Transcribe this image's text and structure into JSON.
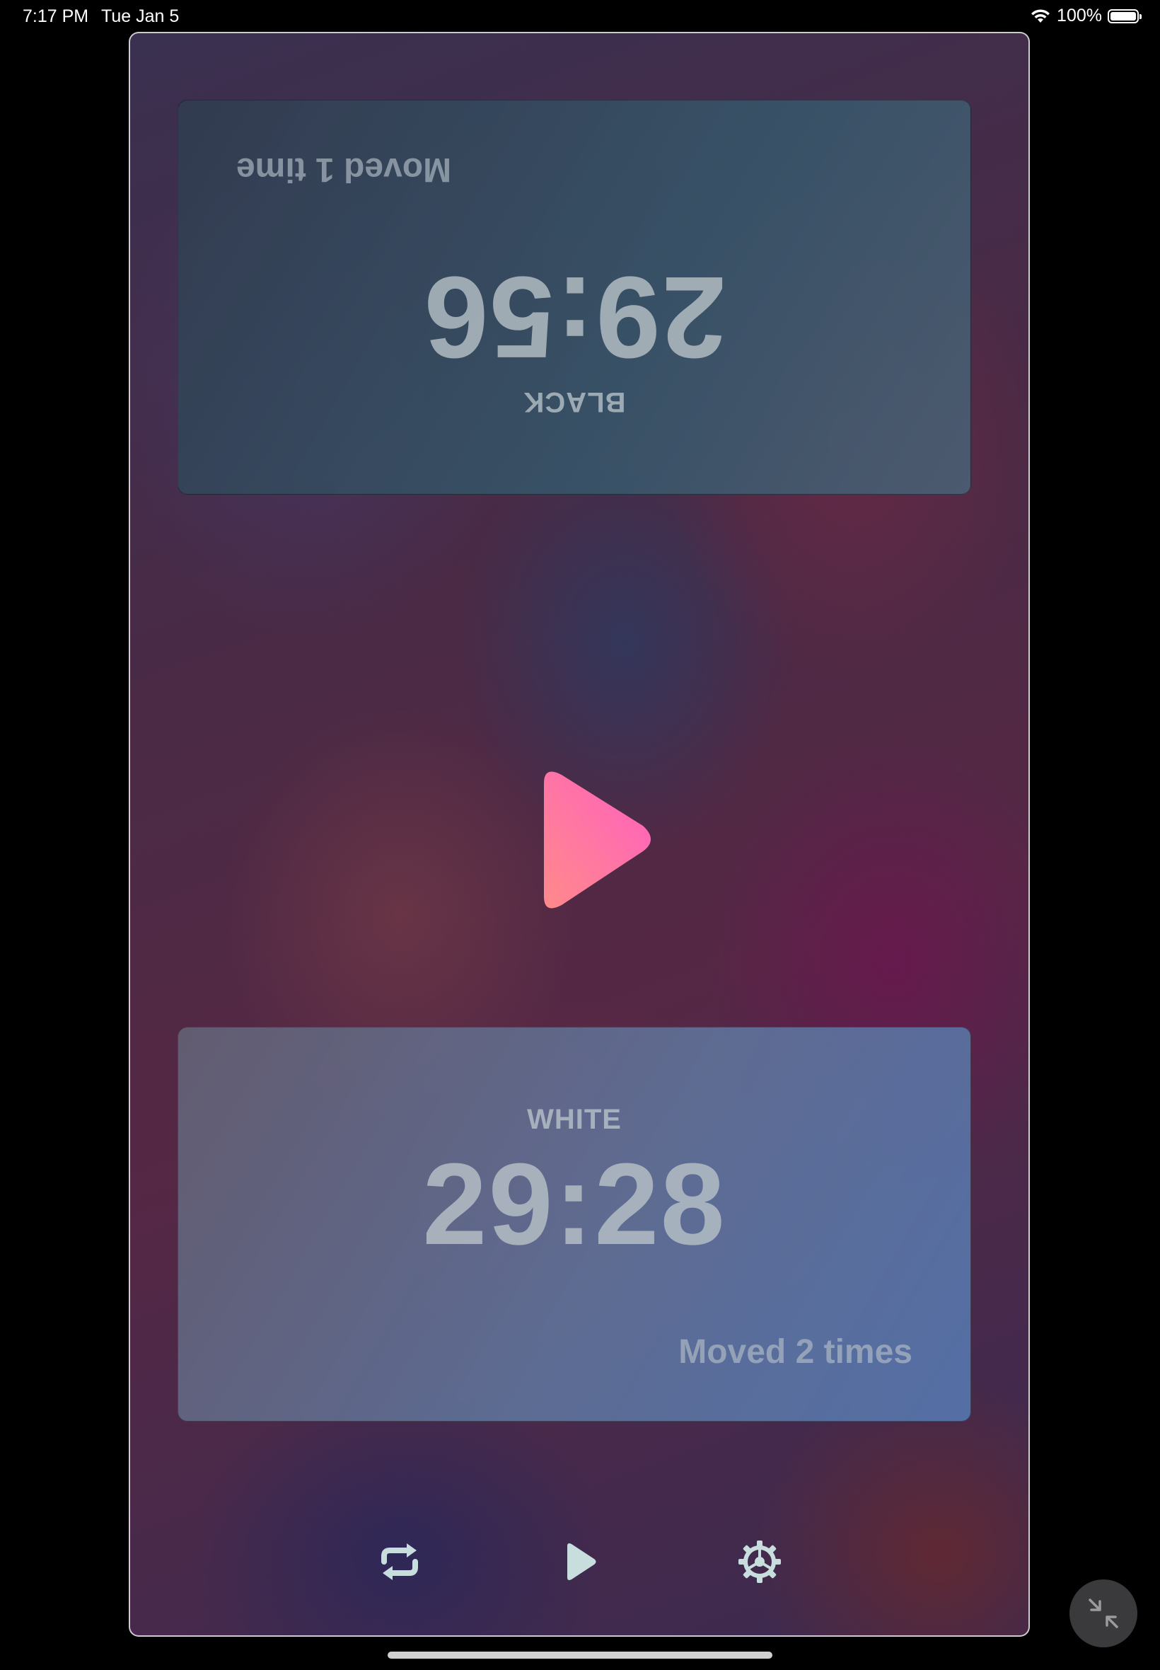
{
  "status_bar": {
    "time": "7:17 PM",
    "date": "Tue Jan 5",
    "battery": "100%",
    "icons": [
      "wifi-icon",
      "battery-icon"
    ]
  },
  "black_clock": {
    "label": "BLACK",
    "time": "29:56",
    "moves": "Moved 1 time"
  },
  "white_clock": {
    "label": "WHITE",
    "time": "29:28",
    "moves": "Moved 2 times"
  },
  "toolbar": {
    "icons": [
      "repeat-icon",
      "play-icon",
      "settings-icon"
    ]
  },
  "overlay": {
    "icons": [
      "minimize-icon"
    ]
  },
  "colors": {
    "play_gradient_start": "#ff8a8a",
    "play_gradient_end": "#ff5fb8",
    "icon_color": "#c8dede"
  }
}
